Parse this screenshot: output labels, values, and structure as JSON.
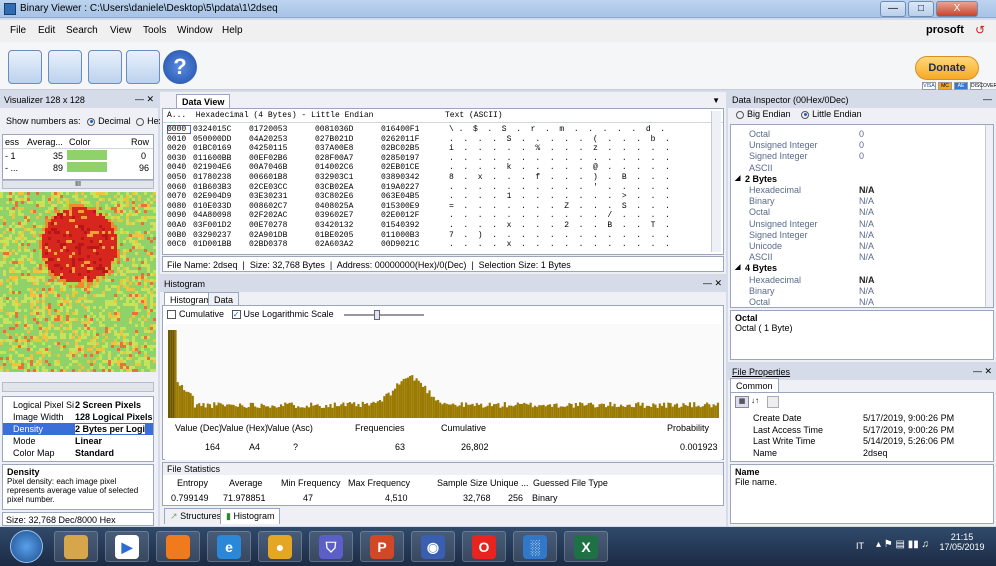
{
  "window": {
    "title": "Binary Viewer : C:\\Users\\daniele\\Desktop\\5\\pdata\\1\\2dseq",
    "minimize": "—",
    "maximize": "□",
    "close": "X"
  },
  "menu": [
    "File",
    "Edit",
    "Search",
    "View",
    "Tools",
    "Window",
    "Help"
  ],
  "brand": "prosoft",
  "donate": {
    "label": "Donate",
    "cards": [
      "VISA",
      "MC",
      "AE",
      "DISCOVER"
    ]
  },
  "visualizer": {
    "title": "Visualizer 128 x 128",
    "show_numbers_label": "Show numbers as:",
    "decimal": "Decimal",
    "hexad": "Hexad",
    "columns": [
      "ess",
      "Averag...",
      "Color",
      "Row"
    ],
    "rows": [
      {
        "a": "- 1",
        "avg": "35",
        "row": "0"
      },
      {
        "a": "- ...",
        "avg": "89",
        "row": "96"
      }
    ],
    "scroll_mark": "III",
    "props": [
      {
        "k": "Logical Pixel Si",
        "v": "2 Screen Pixels"
      },
      {
        "k": "Image Width",
        "v": "128 Logical Pixels"
      },
      {
        "k": "Density",
        "v": "2 Bytes per Logi"
      },
      {
        "k": "Mode",
        "v": "Linear"
      },
      {
        "k": "Color Map",
        "v": "Standard"
      }
    ],
    "desc_title": "Density",
    "desc_text": "Pixel density: each image pixel represents average value of selected pixel number.",
    "status": "Size: 32,768 Dec/8000 Hex"
  },
  "dataview": {
    "tab": "Data View",
    "header": "A...  Hexadecimal (4 Bytes) - Little Endian",
    "text_header": "Text (ASCII)",
    "rows": [
      {
        "addr": "0000",
        "c1": "0324015C",
        "c2": "01720053",
        "c3": "0081036D",
        "c4": "016400F1",
        "t": "\\ .  $  .  S  .  r  .  m  .  .  .  .  .  d  ."
      },
      {
        "addr": "0010",
        "c1": "050000DD",
        "c2": "04A20253",
        "c3": "027B021D",
        "c4": "0262011F",
        "t": ".  .  .  .  S  .  .  .  .  .  (  .  .  .  b  ."
      },
      {
        "addr": "0020",
        "c1": "01BC0169",
        "c2": "04250115",
        "c3": "037A00E8",
        "c4": "02BC02B5",
        "t": "i  .  .  .  .  .  %  .  .  .  z  .  .  .  .  ."
      },
      {
        "addr": "0030",
        "c1": "011600BB",
        "c2": "00EF02B6",
        "c3": "028F00A7",
        "c4": "02850197",
        "t": ".  .  .  .  .  .  .  .  .  .  .  .  .  .  .  ."
      },
      {
        "addr": "0040",
        "c1": "021904E6",
        "c2": "00A7046B",
        "c3": "014002C6",
        "c4": "02EB01CE",
        "t": ".  .  .  .  k  .  .  .  .  .  @  .  .  .  .  ."
      },
      {
        "addr": "0050",
        "c1": "01780238",
        "c2": "006601B8",
        "c3": "032903C1",
        "c4": "03890342",
        "t": "8  .  x  .  .  .  f  .  .  .  )  .  B  .  .  ."
      },
      {
        "addr": "0060",
        "c1": "01B603B3",
        "c2": "02CE03CC",
        "c3": "03CB02EA",
        "c4": "019A0227",
        "t": ".  .  .  .  .  .  .  .  .  .  '  .  .  .  .  ."
      },
      {
        "addr": "0070",
        "c1": "02E904D9",
        "c2": "03E30231",
        "c3": "03C802E6",
        "c4": "063E04B5",
        "t": ".  .  .  .  1  .  .  .  .  .  .  .  >  .  .  ."
      },
      {
        "addr": "0080",
        "c1": "010E033D",
        "c2": "008602C7",
        "c3": "0408025A",
        "c4": "015300E9",
        "t": "=  .  .  .  .  .  .  .  Z  .  .  .  S  .  .  ."
      },
      {
        "addr": "0090",
        "c1": "04A80098",
        "c2": "02F202AC",
        "c3": "039602E7",
        "c4": "02E0012F",
        "t": ".  .  .  .  .  .  .  .  .  .  .  /  .  .  .  ."
      },
      {
        "addr": "00A0",
        "c1": "03F001D2",
        "c2": "00E70278",
        "c3": "03420132",
        "c4": "01540392",
        "t": ".  .  .  .  x  .  .  .  2  .  .  B  .  .  T  ."
      },
      {
        "addr": "00B0",
        "c1": "03290237",
        "c2": "02A901DB",
        "c3": "01BE0205",
        "c4": "011000B3",
        "t": "7  .  )  .  .  .  .  .  .  .  .  .  .  .  .  ."
      },
      {
        "addr": "00C0",
        "c1": "01D001BB",
        "c2": "02BD0378",
        "c3": "02A603A2",
        "c4": "00D9021C",
        "t": ".  .  .  .  x  .  .  .  .  .  .  .  .  .  .  ."
      }
    ],
    "status": "File Name: 2dseq  |  Size: 32,768 Bytes  |  Address: 00000000(Hex)/0(Dec)  |  Selection Size: 1 Bytes"
  },
  "histogram": {
    "title": "Histogram",
    "tabs": [
      "Histogram",
      "Data"
    ],
    "cumulative": "Cumulative",
    "log_scale": "Use Logarithmic Scale",
    "headers": [
      "Value (Dec)",
      "Value (Hex)",
      "Value (Asc)",
      "Frequencies",
      "Cumulative",
      "Probability"
    ],
    "values": [
      "164",
      "A4",
      "?",
      "63",
      "26,802",
      "0.001923"
    ],
    "stats_title": "File Statistics",
    "stats_headers": [
      "Entropy",
      "Average",
      "Min Frequency",
      "Max Frequency",
      "Sample Size",
      "Unique ...",
      "Guessed File Type"
    ],
    "stats_values": [
      "0.799149",
      "71.978851",
      "47",
      "4,510",
      "32,768",
      "256",
      "Binary"
    ],
    "bottom_tabs": [
      "Structures",
      "Histogram"
    ]
  },
  "inspector": {
    "title": "Data Inspector (00Hex/0Dec)",
    "big_endian": "Big Endian",
    "little_endian": "Little Endian",
    "rows": [
      {
        "k": "Octal",
        "v": "0",
        "kind": "row"
      },
      {
        "k": "Unsigned Integer",
        "v": "0",
        "kind": "row"
      },
      {
        "k": "Signed Integer",
        "v": "0",
        "kind": "row"
      },
      {
        "k": "ASCII",
        "v": "",
        "kind": "row"
      },
      {
        "k": "2 Bytes",
        "v": "",
        "kind": "group"
      },
      {
        "k": "Hexadecimal",
        "v": "N/A",
        "kind": "bold"
      },
      {
        "k": "Binary",
        "v": "N/A",
        "kind": "row"
      },
      {
        "k": "Octal",
        "v": "N/A",
        "kind": "row"
      },
      {
        "k": "Unsigned Integer",
        "v": "N/A",
        "kind": "row"
      },
      {
        "k": "Signed Integer",
        "v": "N/A",
        "kind": "row"
      },
      {
        "k": "Unicode",
        "v": "N/A",
        "kind": "row"
      },
      {
        "k": "ASCII",
        "v": "N/A",
        "kind": "row"
      },
      {
        "k": "4 Bytes",
        "v": "",
        "kind": "group"
      },
      {
        "k": "Hexadecimal",
        "v": "N/A",
        "kind": "bold"
      },
      {
        "k": "Binary",
        "v": "N/A",
        "kind": "row"
      },
      {
        "k": "Octal",
        "v": "N/A",
        "kind": "row"
      }
    ],
    "desc_title": "Octal",
    "desc_text": "Octal ( 1 Byte)"
  },
  "fileprops": {
    "title": "File Properties",
    "tab": "Common",
    "rows": [
      {
        "k": "Create Date",
        "v": "5/17/2019, 9:00:26 PM"
      },
      {
        "k": "Last Access Time",
        "v": "5/17/2019, 9:00:26 PM"
      },
      {
        "k": "Last Write Time",
        "v": "5/14/2019, 5:26:06 PM"
      },
      {
        "k": "Name",
        "v": "2dseq"
      }
    ],
    "desc_title": "Name",
    "desc_text": "File name."
  },
  "taskbar": {
    "icons": [
      "start",
      "file-explorer",
      "media-player",
      "firefox",
      "internet-explorer",
      "chrome",
      "teams",
      "powerpoint",
      "misc-app",
      "opera",
      "binary-viewer",
      "excel"
    ],
    "lang": "IT",
    "time": "21:15",
    "date": "17/05/2019"
  },
  "colors": {
    "accent": "#1b5fbf",
    "heat_red": "#d7261e",
    "heat_green": "#8fd26a",
    "hist_bar": "#9a7a00"
  }
}
